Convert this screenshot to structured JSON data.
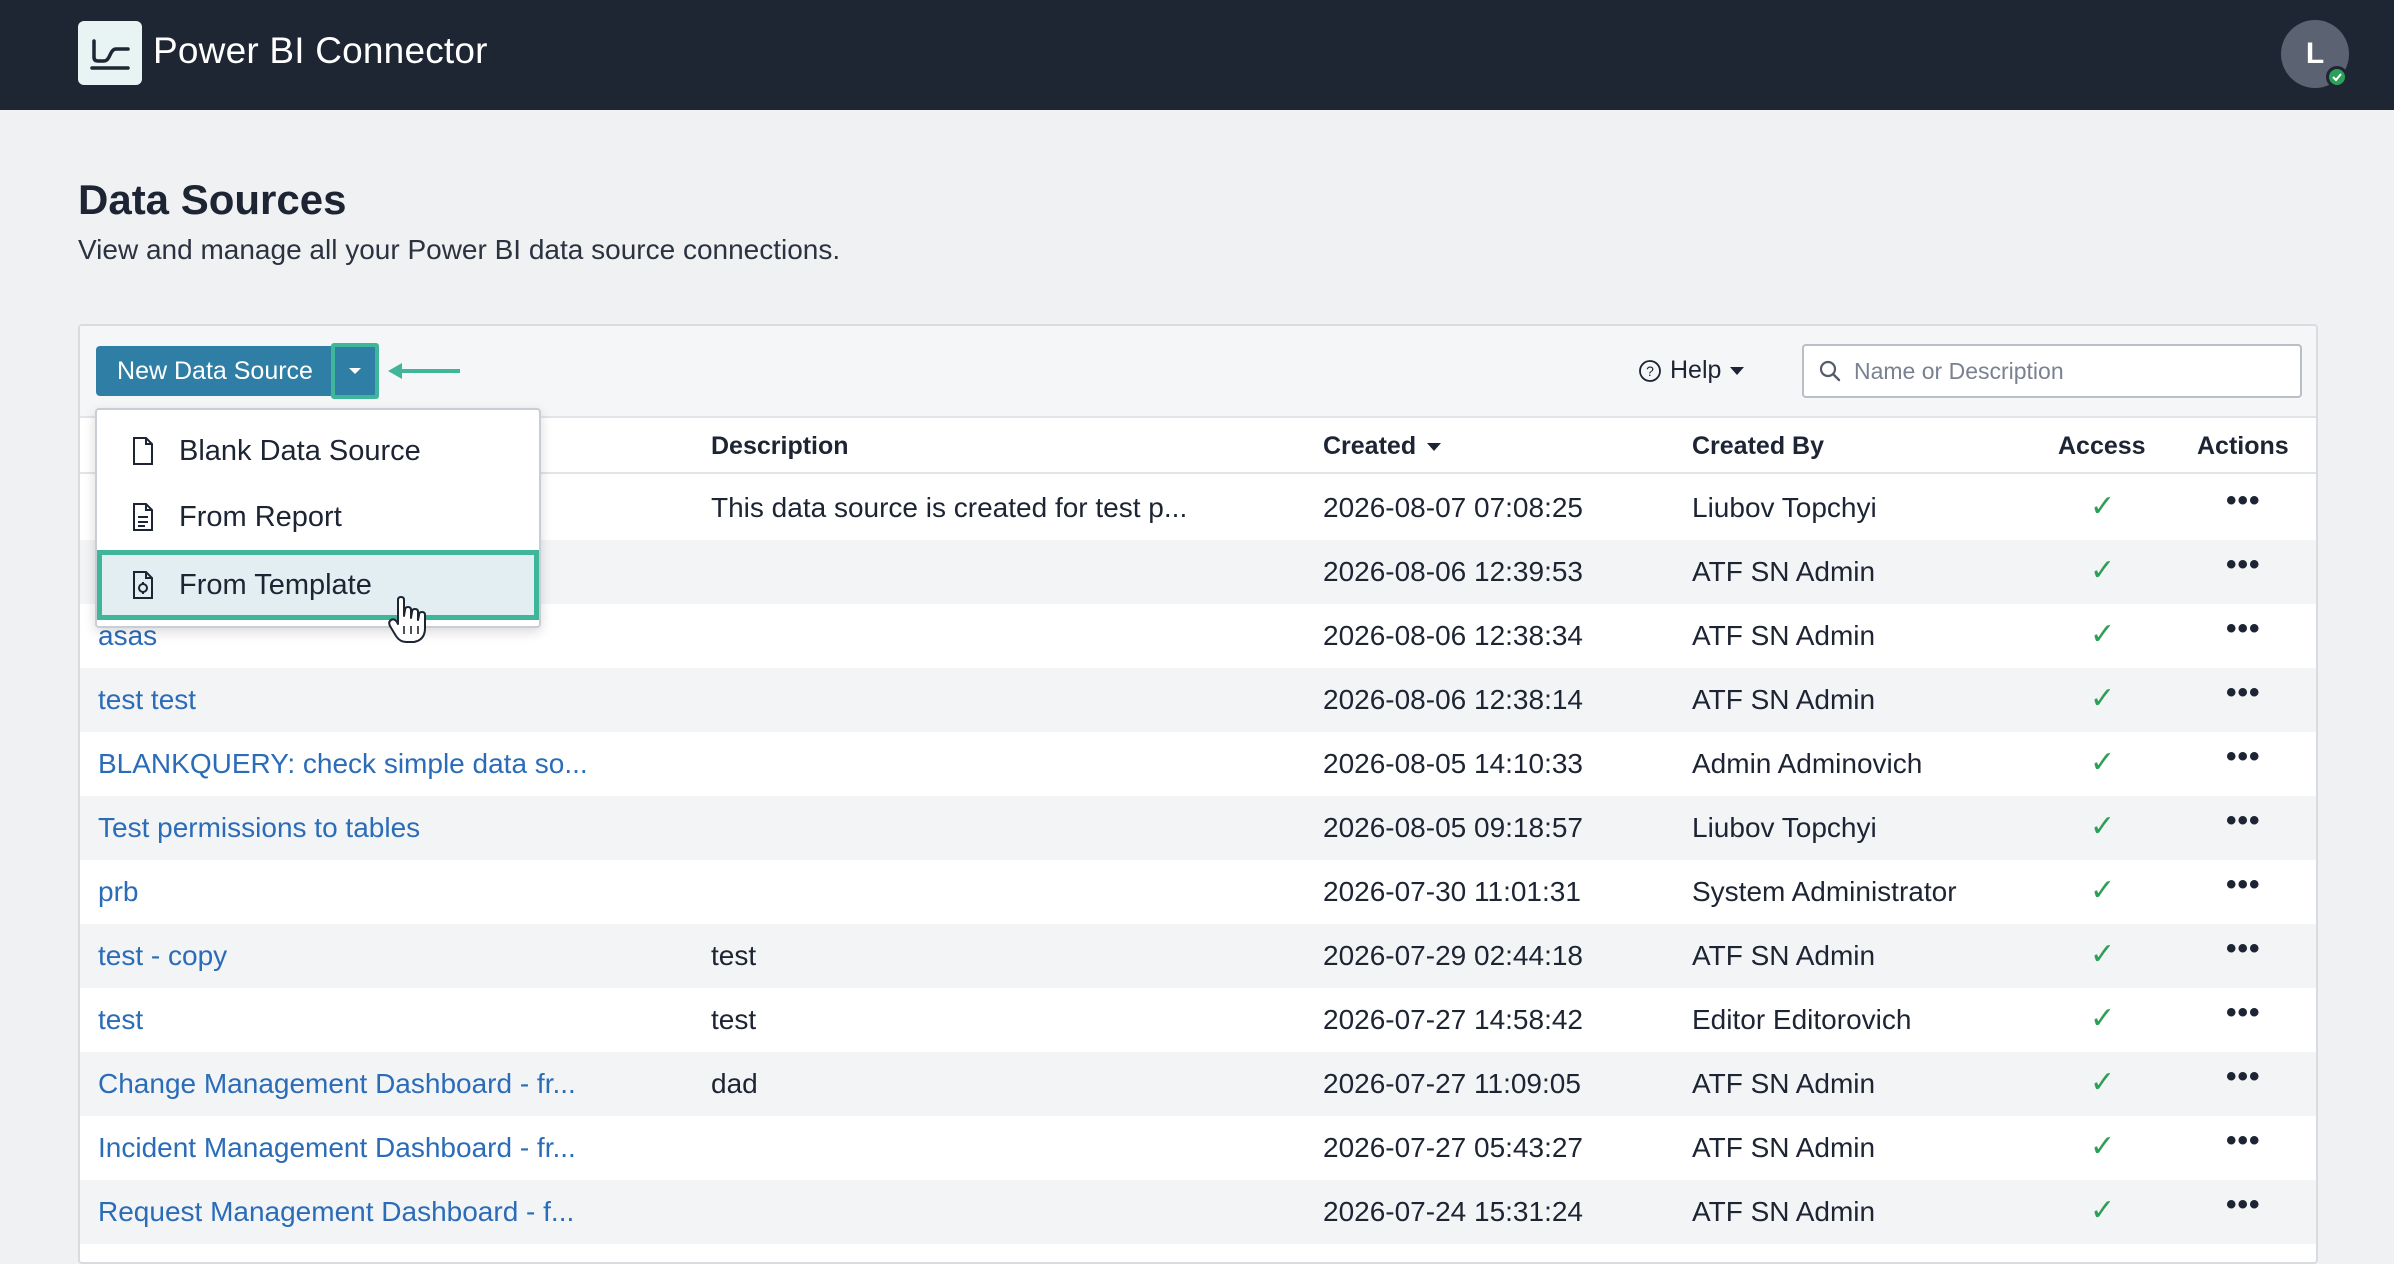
{
  "app": {
    "title": "Power BI Connector",
    "user_initial": "L"
  },
  "page": {
    "title": "Data Sources",
    "subtitle": "View and manage all your Power BI data source connections."
  },
  "toolbar": {
    "new_button_label": "New Data Source",
    "help_label": "Help",
    "search_placeholder": "Name or Description"
  },
  "dropdown": {
    "items": [
      {
        "label": "Blank Data Source",
        "icon": "document-icon"
      },
      {
        "label": "From Report",
        "icon": "report-document-icon"
      },
      {
        "label": "From Template",
        "icon": "template-document-icon"
      }
    ],
    "highlighted": "From Template"
  },
  "table": {
    "columns": [
      "Description",
      "Created",
      "Created By",
      "Access",
      "Actions"
    ],
    "sort_column": "Created",
    "rows": [
      {
        "name": "",
        "description": "This data source is created for test p...",
        "created": "2026-08-07 07:08:25",
        "created_by": "Liubov Topchyi",
        "access": "✓",
        "actions": "•••"
      },
      {
        "name": "",
        "description": "",
        "created": "2026-08-06 12:39:53",
        "created_by": "ATF SN Admin",
        "access": "✓",
        "actions": "•••"
      },
      {
        "name": "asas",
        "description": "",
        "created": "2026-08-06 12:38:34",
        "created_by": "ATF SN Admin",
        "access": "✓",
        "actions": "•••"
      },
      {
        "name": "test test",
        "description": "",
        "created": "2026-08-06 12:38:14",
        "created_by": "ATF SN Admin",
        "access": "✓",
        "actions": "•••"
      },
      {
        "name": "BLANKQUERY: check simple data so...",
        "description": "",
        "created": "2026-08-05 14:10:33",
        "created_by": "Admin Adminovich",
        "access": "✓",
        "actions": "•••"
      },
      {
        "name": "Test permissions to tables",
        "description": "",
        "created": "2026-08-05 09:18:57",
        "created_by": "Liubov Topchyi",
        "access": "✓",
        "actions": "•••"
      },
      {
        "name": "prb",
        "description": "",
        "created": "2026-07-30 11:01:31",
        "created_by": "System Administrator",
        "access": "✓",
        "actions": "•••"
      },
      {
        "name": "test - copy",
        "description": "test",
        "created": "2026-07-29 02:44:18",
        "created_by": "ATF SN Admin",
        "access": "✓",
        "actions": "•••"
      },
      {
        "name": "test",
        "description": "test",
        "created": "2026-07-27 14:58:42",
        "created_by": "Editor Editorovich",
        "access": "✓",
        "actions": "•••"
      },
      {
        "name": "Change Management Dashboard - fr...",
        "description": "dad",
        "created": "2026-07-27 11:09:05",
        "created_by": "ATF SN Admin",
        "access": "✓",
        "actions": "•••"
      },
      {
        "name": "Incident Management Dashboard - fr...",
        "description": "",
        "created": "2026-07-27 05:43:27",
        "created_by": "ATF SN Admin",
        "access": "✓",
        "actions": "•••"
      },
      {
        "name": "Request Management Dashboard - f...",
        "description": "",
        "created": "2026-07-24 15:31:24",
        "created_by": "ATF SN Admin",
        "access": "✓",
        "actions": "•••"
      }
    ]
  },
  "colors": {
    "topbar": "#1e2533",
    "primary": "#2e7ea6",
    "highlight": "#3fb699",
    "link": "#2b6cb8",
    "check": "#2e9e5b"
  }
}
